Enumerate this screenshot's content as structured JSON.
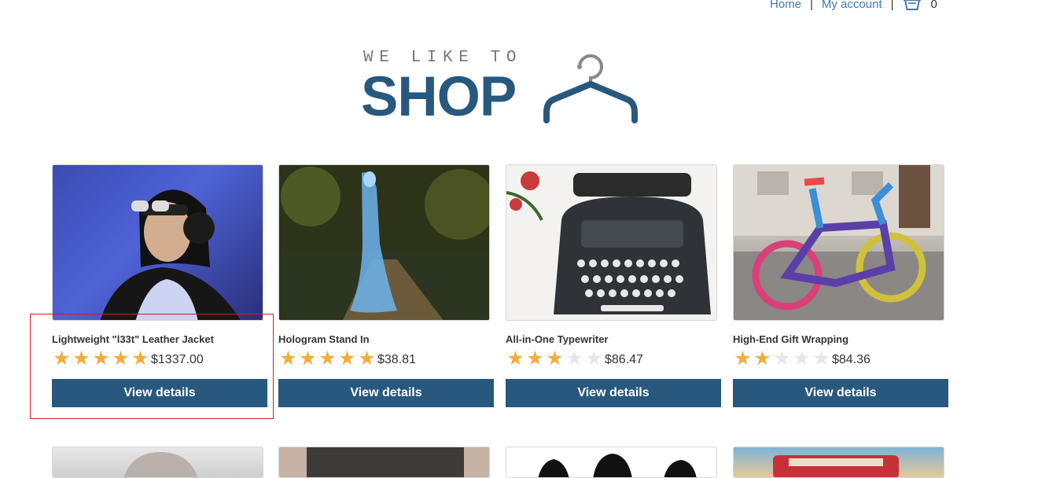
{
  "nav": {
    "home": "Home",
    "separator": "|",
    "my_account": "My account",
    "cart_count": "0"
  },
  "logo": {
    "tagline": "WE LIKE TO",
    "word": "SHOP"
  },
  "products": [
    {
      "name": "Lightweight \"l33t\" Leather Jacket",
      "rating": 5,
      "price": "$1337.00",
      "button": "View details",
      "image": "woman-with-headphones-photo"
    },
    {
      "name": "Hologram Stand In",
      "rating": 5,
      "price": "$38.81",
      "button": "View details",
      "image": "hologram-woman-in-park-photo"
    },
    {
      "name": "All-in-One Typewriter",
      "rating": 3,
      "price": "$86.47",
      "button": "View details",
      "image": "typewriter-photo"
    },
    {
      "name": "High-End Gift Wrapping",
      "rating": 2,
      "price": "$84.36",
      "button": "View details",
      "image": "yarn-wrapped-bicycle-photo"
    }
  ],
  "colors": {
    "brand": "#28587e",
    "link": "#3d7ab3",
    "star": "#f0ad3c",
    "highlight": "#cc1f1f"
  }
}
